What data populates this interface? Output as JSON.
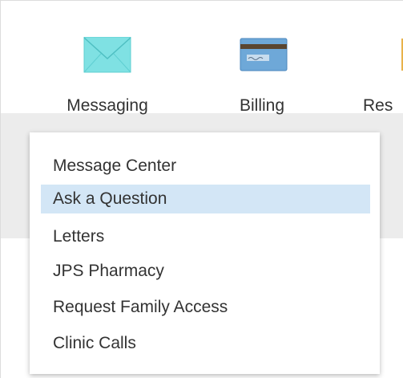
{
  "nav": {
    "items": [
      {
        "label": "Messaging",
        "icon": "envelope-icon",
        "color": "#7fe1e3"
      },
      {
        "label": "Billing",
        "icon": "credit-card-icon",
        "color": "#6ea8d8"
      },
      {
        "label": "Res",
        "icon": "resources-icon",
        "color": "#e8b24a"
      }
    ]
  },
  "dropdown": {
    "highlight_color": "#d3e6f6",
    "items": [
      {
        "label": "Message Center"
      },
      {
        "label": "Ask a Question",
        "highlighted": true
      },
      {
        "label": "Letters"
      },
      {
        "label": "JPS Pharmacy"
      },
      {
        "label": "Request Family Access"
      },
      {
        "label": "Clinic Calls"
      }
    ]
  }
}
